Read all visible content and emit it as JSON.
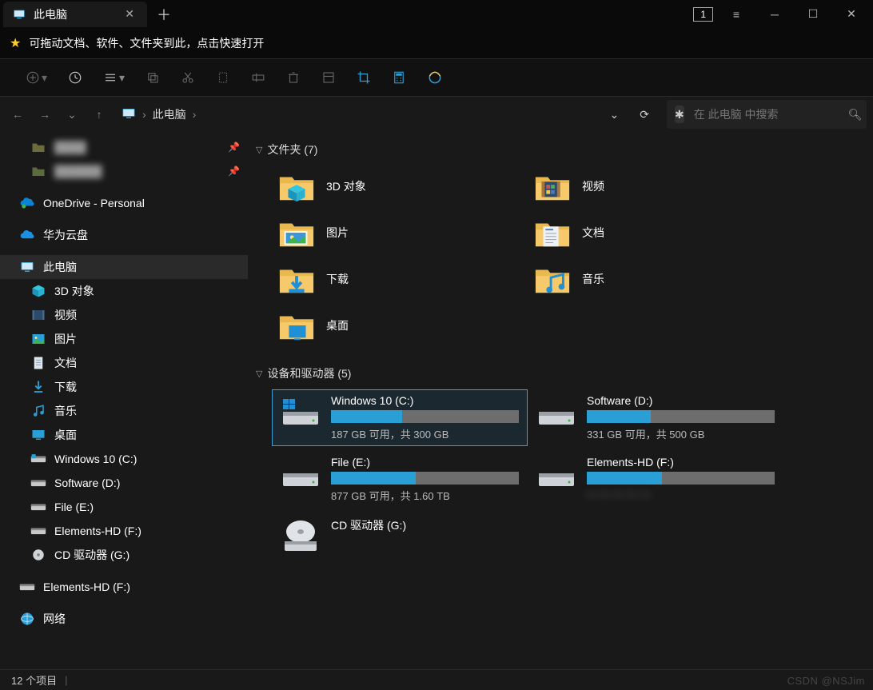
{
  "tab": {
    "title": "此电脑"
  },
  "favbar_hint": "可拖动文档、软件、文件夹到此，点击快速打开",
  "breadcrumb": {
    "root": "此电脑"
  },
  "search_placeholder": "在 此电脑 中搜索",
  "title_number": "1",
  "sidebar": {
    "quick": [
      {
        "label": "",
        "iconColor": "#6b6b3b",
        "pinned": true,
        "blurred": true
      },
      {
        "label": "",
        "iconColor": "#5b6b3b",
        "pinned": true,
        "blurred": true
      }
    ],
    "onedrive": "OneDrive - Personal",
    "huawei": "华为云盘",
    "thispc": "此电脑",
    "thispc_children": [
      {
        "label": "3D 对象",
        "icon": "cube"
      },
      {
        "label": "视频",
        "icon": "video"
      },
      {
        "label": "图片",
        "icon": "picture"
      },
      {
        "label": "文档",
        "icon": "doc"
      },
      {
        "label": "下载",
        "icon": "download"
      },
      {
        "label": "音乐",
        "icon": "music"
      },
      {
        "label": "桌面",
        "icon": "desktop"
      },
      {
        "label": "Windows 10 (C:)",
        "icon": "drive-win"
      },
      {
        "label": "Software (D:)",
        "icon": "drive"
      },
      {
        "label": "File (E:)",
        "icon": "drive"
      },
      {
        "label": "Elements-HD (F:)",
        "icon": "drive"
      },
      {
        "label": "CD 驱动器 (G:)",
        "icon": "cd"
      }
    ],
    "external": "Elements-HD (F:)",
    "network": "网络"
  },
  "groups": {
    "folders_header": "文件夹 (7)",
    "drives_header": "设备和驱动器 (5)"
  },
  "folders": [
    {
      "label": "3D 对象",
      "type": "cube"
    },
    {
      "label": "视频",
      "type": "video"
    },
    {
      "label": "图片",
      "type": "picture"
    },
    {
      "label": "文档",
      "type": "doc"
    },
    {
      "label": "下载",
      "type": "download"
    },
    {
      "label": "音乐",
      "type": "music"
    },
    {
      "label": "桌面",
      "type": "desktop"
    }
  ],
  "drives": [
    {
      "label": "Windows 10 (C:)",
      "sub": "187 GB 可用，共 300 GB",
      "fill": 38,
      "type": "win",
      "selected": true
    },
    {
      "label": "Software (D:)",
      "sub": "331 GB 可用，共 500 GB",
      "fill": 34,
      "type": "hdd"
    },
    {
      "label": "File (E:)",
      "sub": "877 GB 可用，共 1.60 TB",
      "fill": 45,
      "type": "hdd"
    },
    {
      "label": "Elements-HD (F:)",
      "sub": "— — — — —",
      "fill": 40,
      "type": "hdd",
      "blurred": true
    },
    {
      "label": "CD 驱动器 (G:)",
      "sub": "",
      "fill": 0,
      "type": "cd"
    }
  ],
  "status": "12 个项目",
  "watermark": "CSDN @NSJim"
}
